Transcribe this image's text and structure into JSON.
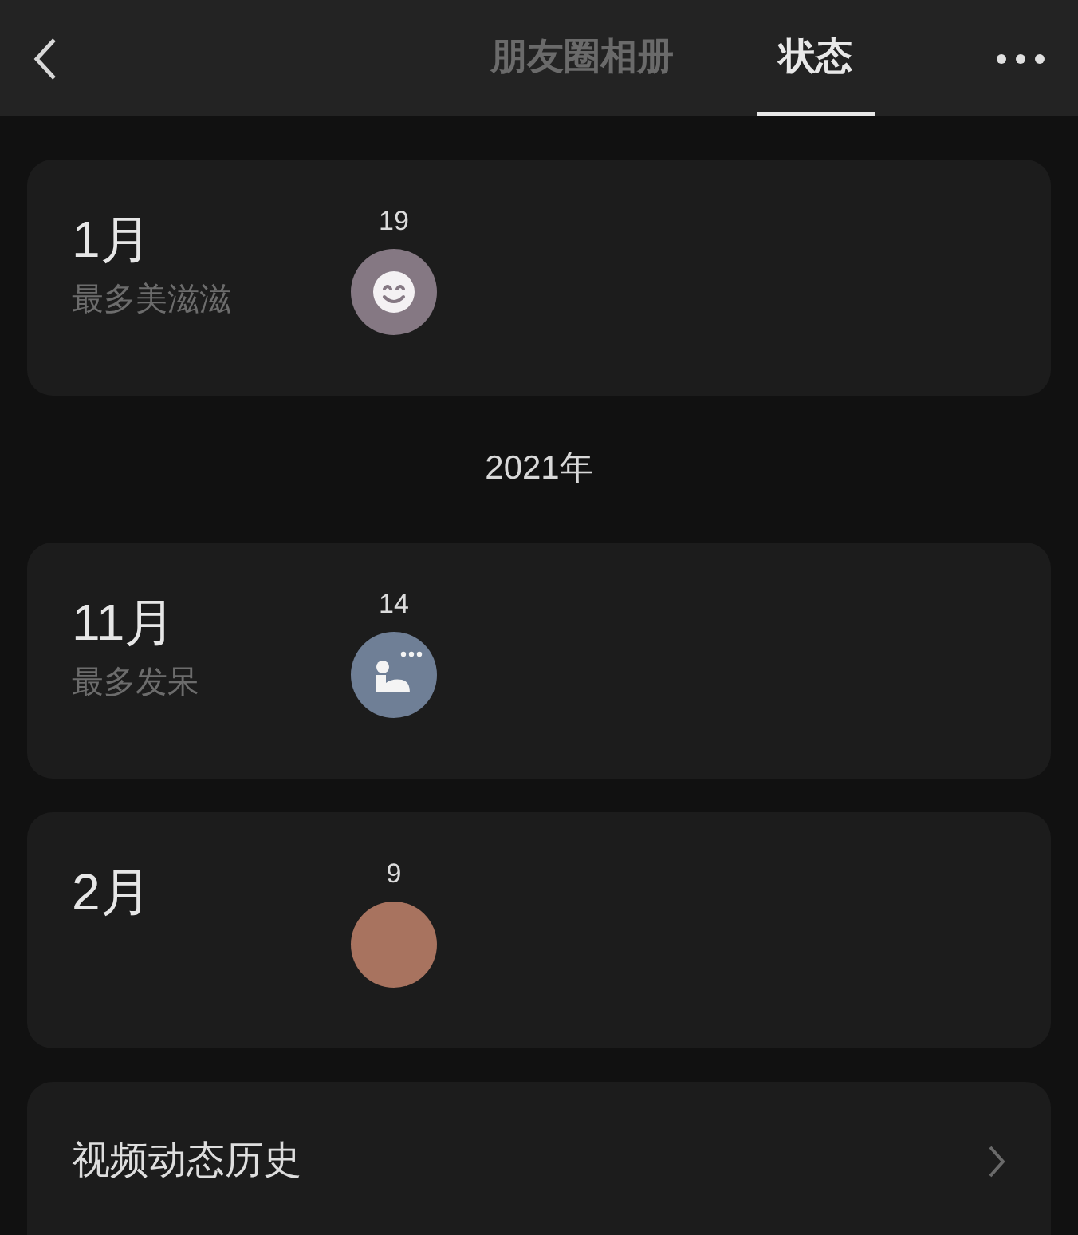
{
  "tabs": [
    {
      "label": "朋友圈相册",
      "selected": false
    },
    {
      "label": "状态",
      "selected": true
    }
  ],
  "entries": [
    {
      "kind": "month",
      "month": "1月",
      "subtitle": "最多美滋滋",
      "count": "19",
      "status": {
        "kind": "smile",
        "color": "#857883"
      }
    },
    {
      "kind": "year",
      "label": "2021年"
    },
    {
      "kind": "month",
      "month": "11月",
      "subtitle": "最多发呆",
      "count": "14",
      "status": {
        "kind": "daze",
        "color": "#6f7f96"
      }
    },
    {
      "kind": "month",
      "month": "2月",
      "count": "9",
      "status": {
        "kind": "plain",
        "color": "#a8735f"
      }
    },
    {
      "kind": "link",
      "label": "视频动态历史"
    }
  ]
}
